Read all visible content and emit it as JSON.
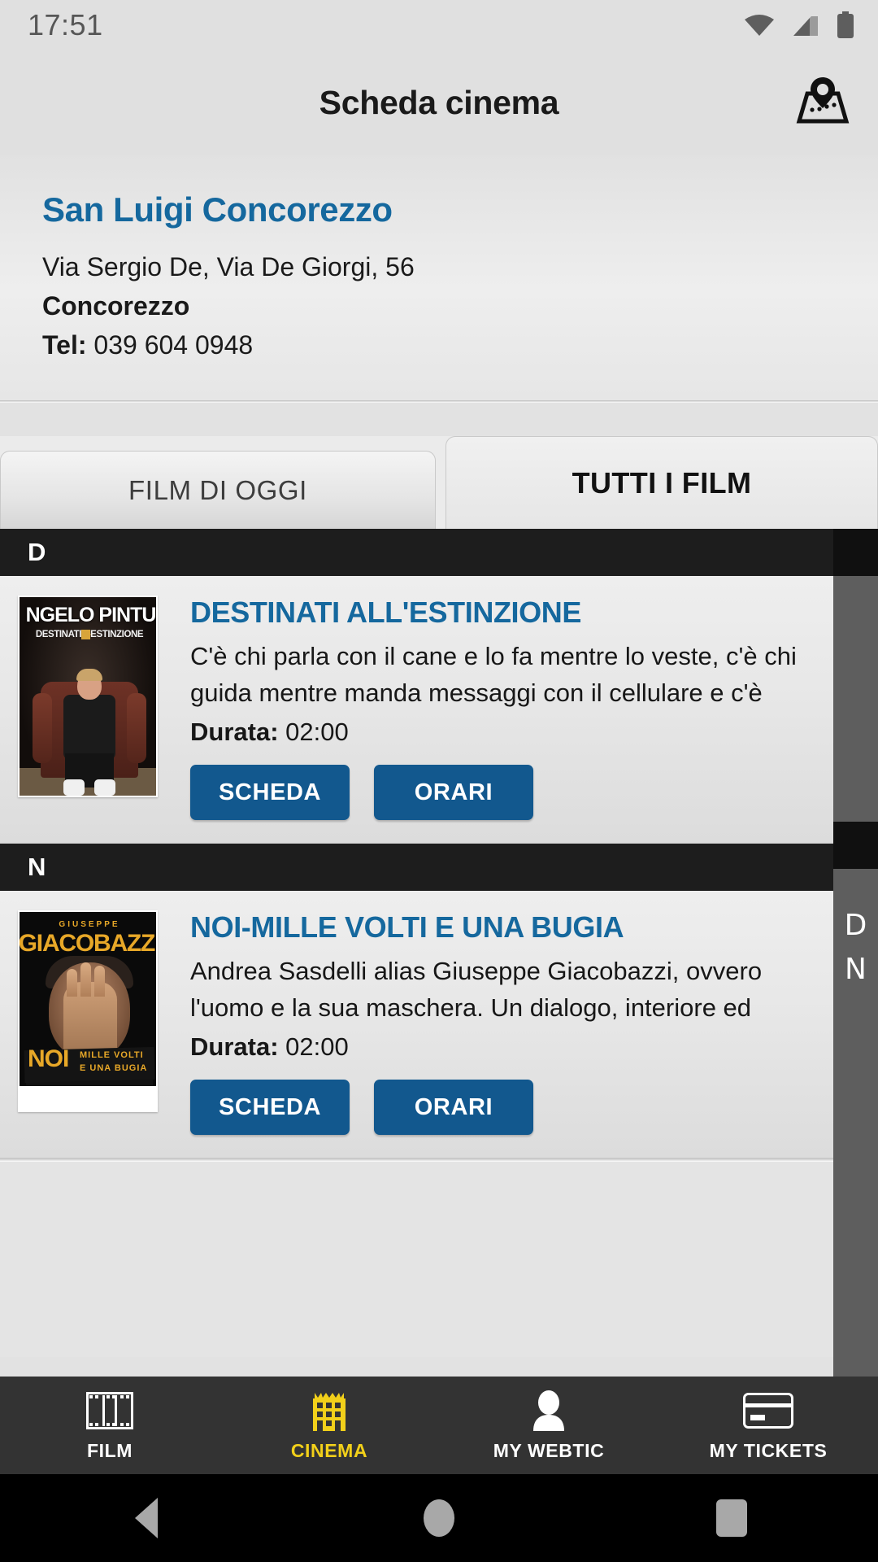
{
  "status_bar": {
    "time": "17:51",
    "icons": [
      "wifi-icon",
      "cellular-signal-icon",
      "battery-icon"
    ]
  },
  "header": {
    "title": "Scheda cinema",
    "map_button": "map-pin-icon"
  },
  "cinema": {
    "name": "San Luigi Concorezzo",
    "address": "Via Sergio De, Via De Giorgi, 56",
    "city": "Concorezzo",
    "tel_label": "Tel:",
    "tel_value": "039 604 0948"
  },
  "tabs": [
    {
      "label": "FILM DI OGGI",
      "active": false
    },
    {
      "label": "TUTTI I FILM",
      "active": true
    }
  ],
  "sections": [
    {
      "letter": "D",
      "movies": [
        {
          "title": "DESTINATI ALL'ESTINZIONE",
          "description": "C'è chi parla con il cane e lo fa mentre lo veste, c'è chi guida mentre manda messaggi con il cellulare e c'è ch…",
          "duration_label": "Durata:",
          "duration_value": "02:00",
          "buttons": {
            "details": "SCHEDA",
            "showtimes": "ORARI"
          },
          "poster": {
            "artist": "NGELO PINTU",
            "subtitle_left": "DESTINATI",
            "subtitle_right": "ESTINZIONE"
          }
        }
      ]
    },
    {
      "letter": "N",
      "movies": [
        {
          "title": "NOI-MILLE VOLTI E UNA BUGIA",
          "description": "Andrea Sasdelli alias Giuseppe Giacobazzi, ovvero l'uomo e la sua maschera. Un dialogo, interiore ed esil…",
          "duration_label": "Durata:",
          "duration_value": "02:00",
          "buttons": {
            "details": "SCHEDA",
            "showtimes": "ORARI"
          },
          "poster": {
            "sup": "GIUSEPPE",
            "artist": "GIACOBAZZI",
            "main": "NOI",
            "tag1": "MILLE  VOLTI",
            "tag2": "E UNA BUGIA"
          }
        }
      ]
    }
  ],
  "index_strip": {
    "letters": [
      "D",
      "N"
    ]
  },
  "bottom_nav": [
    {
      "label": "FILM",
      "icon": "film-strip-icon",
      "active": false
    },
    {
      "label": "CINEMA",
      "icon": "cinema-building-icon",
      "active": true
    },
    {
      "label": "MY WEBTIC",
      "icon": "person-icon",
      "active": false
    },
    {
      "label": "MY TICKETS",
      "icon": "ticket-card-icon",
      "active": false
    }
  ],
  "android_nav": {
    "back": "back-triangle-icon",
    "home": "home-circle-icon",
    "recents": "recents-square-icon"
  },
  "colors": {
    "accent_blue": "#15689e",
    "button_blue": "#12588e",
    "active_nav_yellow": "#f2d01a",
    "section_header_bg": "#1d1d1d"
  }
}
